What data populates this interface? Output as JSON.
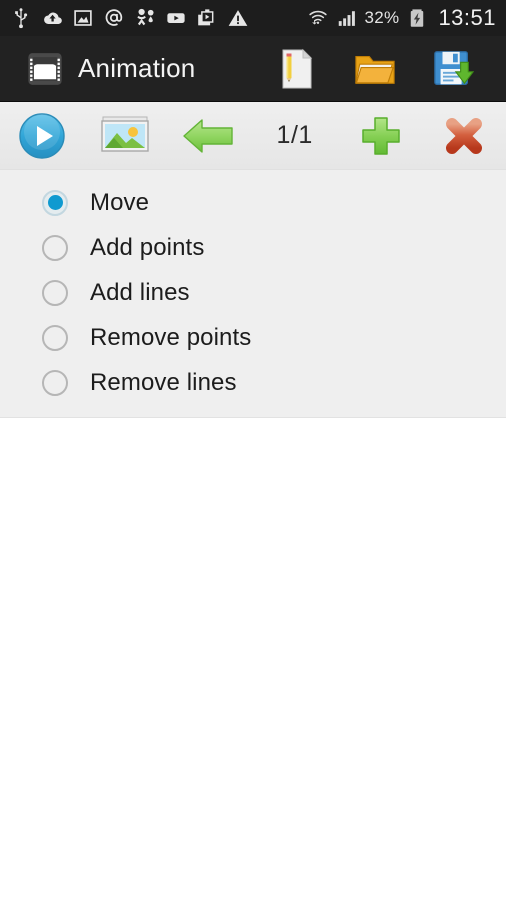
{
  "status_bar": {
    "icons": [
      {
        "name": "usb-icon",
        "label": "USB"
      },
      {
        "name": "cloud-upload-icon",
        "label": "Cloud"
      },
      {
        "name": "screenshot-icon",
        "label": "Screenshot"
      },
      {
        "name": "at-mention-icon",
        "label": "Mail"
      },
      {
        "name": "odnoklassniki-icon",
        "label": "Odnoklassniki"
      },
      {
        "name": "youtube-icon",
        "label": "YouTube"
      },
      {
        "name": "play-store-icon",
        "label": "Play Store"
      },
      {
        "name": "warning-icon",
        "label": "Warning"
      }
    ],
    "wifi_icon": "wifi-icon",
    "signal_icon": "cellular-signal-icon",
    "battery_percent": "32%",
    "battery_icon": "battery-charging-icon",
    "clock": "13:51"
  },
  "title_bar": {
    "app_icon": "film-strip-icon",
    "title": "Animation",
    "actions": [
      {
        "name": "new-document-button",
        "icon": "document-pencil-icon",
        "label": "New"
      },
      {
        "name": "open-folder-button",
        "icon": "folder-open-icon",
        "label": "Open"
      },
      {
        "name": "save-button",
        "icon": "floppy-save-icon",
        "label": "Save"
      }
    ]
  },
  "toolbar": {
    "play_label": "Play",
    "play_icon": "play-circle-icon",
    "image_label": "Background image",
    "image_icon": "picture-icon",
    "back_label": "Previous frame",
    "back_icon": "arrow-left-icon",
    "frame_counter": "1/1",
    "add_label": "Add frame",
    "add_icon": "plus-icon",
    "delete_label": "Delete frame",
    "delete_icon": "close-x-icon"
  },
  "tool_modes": {
    "selected": "Move",
    "options": [
      {
        "label": "Move",
        "checked": true
      },
      {
        "label": "Add points",
        "checked": false
      },
      {
        "label": "Add lines",
        "checked": false
      },
      {
        "label": "Remove points",
        "checked": false
      },
      {
        "label": "Remove lines",
        "checked": false
      }
    ]
  },
  "colors": {
    "status_bar_bg": "#1d1d1d",
    "title_bar_bg": "#222222",
    "toolbar_bg": "#eaeaea",
    "panel_bg": "#efefef",
    "canvas_bg": "#ffffff",
    "accent_blue": "#0f9ad0",
    "accent_green": "#7ed04e",
    "accent_red": "#d1472c"
  }
}
